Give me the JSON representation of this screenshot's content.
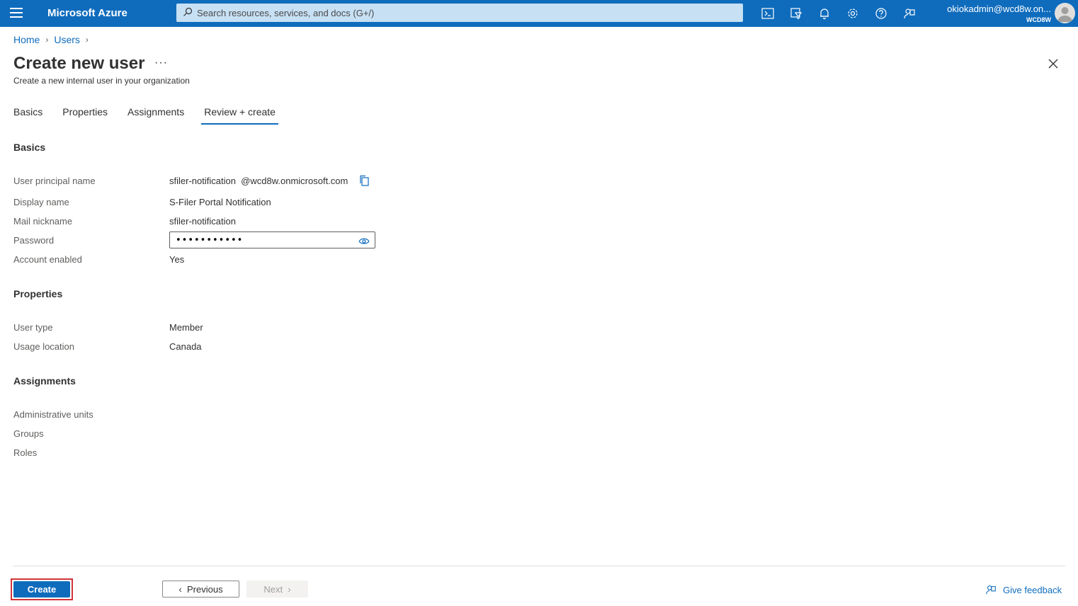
{
  "topbar": {
    "brand": "Microsoft Azure",
    "search_placeholder": "Search resources, services, and docs (G+/)",
    "account_email": "okiokadmin@wcd8w.on...",
    "account_tenant": "WCD8W",
    "icons": [
      "cloud-shell-icon",
      "directory-filter-icon",
      "notifications-icon",
      "settings-icon",
      "help-icon",
      "feedback-icon"
    ]
  },
  "breadcrumb": {
    "home": "Home",
    "users": "Users",
    "separator": ">"
  },
  "page": {
    "title": "Create new user",
    "more": "···",
    "subtitle": "Create a new internal user in your organization"
  },
  "tabs": [
    {
      "label": "Basics"
    },
    {
      "label": "Properties"
    },
    {
      "label": "Assignments"
    },
    {
      "label": "Review + create",
      "active": true
    }
  ],
  "basics": {
    "heading": "Basics",
    "upn_label": "User principal name",
    "upn_value": "sfiler-notification",
    "upn_domain": "@wcd8w.onmicrosoft.com",
    "display_name_label": "Display name",
    "display_name_value": "S-Filer Portal Notification",
    "mail_nickname_label": "Mail nickname",
    "mail_nickname_value": "sfiler-notification",
    "password_label": "Password",
    "password_value": "•••••••••••",
    "account_enabled_label": "Account enabled",
    "account_enabled_value": "Yes"
  },
  "properties": {
    "heading": "Properties",
    "user_type_label": "User type",
    "user_type_value": "Member",
    "usage_location_label": "Usage location",
    "usage_location_value": "Canada"
  },
  "assignments": {
    "heading": "Assignments",
    "admin_units_label": "Administrative units",
    "groups_label": "Groups",
    "roles_label": "Roles"
  },
  "footer": {
    "create": "Create",
    "previous": "Previous",
    "next": "Next",
    "feedback": "Give feedback"
  },
  "colors": {
    "brand": "#0f6cbd",
    "highlight": "#d13438"
  }
}
